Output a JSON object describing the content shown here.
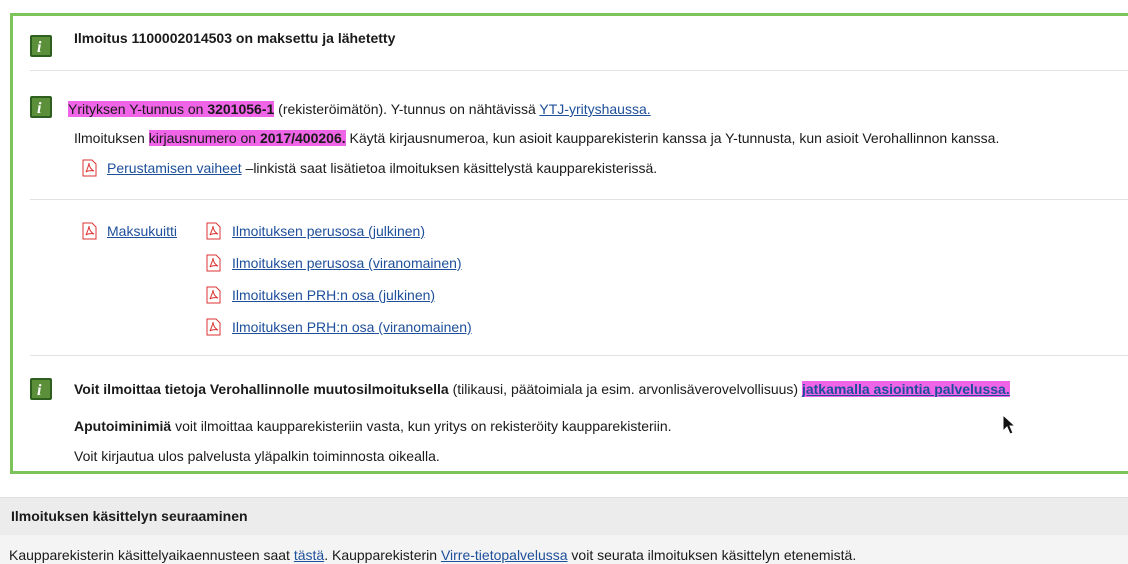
{
  "notice1": {
    "text": "Ilmoitus 1100002014503 on maksettu ja lähetetty"
  },
  "notice2": {
    "line1": {
      "a": "Yrityksen Y-tunnus on ",
      "b": "3201056-1",
      "c": " (rekisteröimätön). Y-tunnus on nähtävissä ",
      "link": "YTJ-yrityshaussa."
    },
    "line2": {
      "a": "Ilmoituksen ",
      "b": "kirjausnumero on ",
      "c": "2017/400206.",
      "d": " Käytä kirjausnumeroa, kun asioit kaupparekisterin kanssa ja Y-tunnusta, kun asioit Verohallinnon kanssa."
    },
    "line3": {
      "link": "Perustamisen vaiheet",
      "a": " –linkistä saat lisätietoa ilmoituksen käsittelystä kaupparekisterissä."
    }
  },
  "documents": {
    "receipt": "Maksukuitti",
    "items": [
      "Ilmoituksen perusosa (julkinen)",
      "Ilmoituksen perusosa (viranomainen)",
      "Ilmoituksen PRH:n osa (julkinen)",
      "Ilmoituksen PRH:n osa (viranomainen)"
    ]
  },
  "notice3": {
    "line1": {
      "bold": "Voit ilmoittaa tietoja Verohallinnolle muutosilmoituksella",
      "a": " (tilikausi, päätoimiala ja esim. arvonlisäverovelvollisuus) ",
      "link": "jatkamalla asiointia palvelussa."
    },
    "line2": {
      "bold": "Aputoiminimiä",
      "a": " voit ilmoittaa kaupparekisteriin vasta, kun yritys on rekisteröity kaupparekisteriin."
    },
    "line3": "Voit kirjautua ulos palvelusta yläpalkin toiminnosta oikealla."
  },
  "tracking": {
    "title": "Ilmoituksen käsittelyn seuraaminen",
    "a": "Kaupparekisterin käsittelyaikaennusteen saat ",
    "link1": "tästä",
    "b": ". Kaupparekisterin ",
    "link2": "Virre-tietopalvelussa",
    "c": " voit seurata ilmoituksen käsittelyn etenemistä."
  },
  "colors": {
    "border": "#7cc45a",
    "highlight": "#f064e8",
    "link": "#1d4f9a",
    "infoIcon": "#5c8f3a"
  }
}
